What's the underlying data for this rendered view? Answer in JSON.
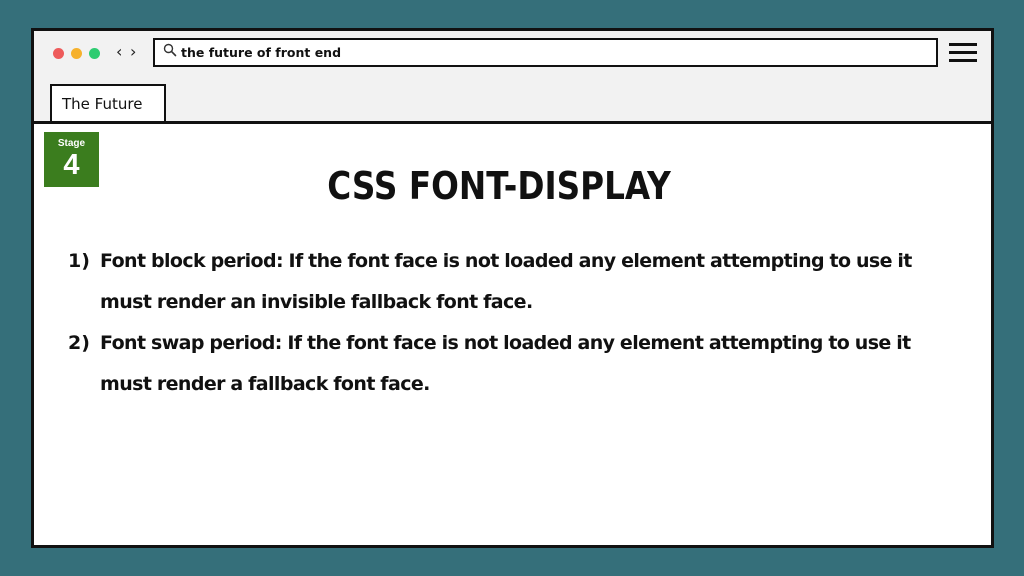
{
  "colors": {
    "background": "#356f7a",
    "window_bg": "#ffffff",
    "toolbar_bg": "#f2f2f2",
    "border": "#111111",
    "close_dot": "#ee5b5b",
    "minimize_dot": "#f6b12c",
    "maximize_dot": "#2ecc71",
    "stage_badge": "#3b7d1e"
  },
  "window_controls": {
    "close_icon": "red-dot-icon",
    "minimize_icon": "yellow-dot-icon",
    "maximize_icon": "green-dot-icon"
  },
  "navigation": {
    "back_glyph": "‹",
    "forward_glyph": "›"
  },
  "address_bar": {
    "icon": "search-icon",
    "value": "the future of front end"
  },
  "menu": {
    "icon": "hamburger-menu-icon"
  },
  "tabs": [
    {
      "label": "The Future",
      "active": true
    }
  ],
  "stage_badge": {
    "label": "Stage",
    "number": "4"
  },
  "page": {
    "title": "CSS FONT-DISPLAY",
    "items": [
      {
        "number": "1)",
        "text": "Font block period: If the font face is not loaded any element attempting to use it must render an invisible fallback font face."
      },
      {
        "number": "2)",
        "text": "Font swap period: If the font face is not loaded any element attempting to use it must render a fallback font face."
      }
    ]
  }
}
